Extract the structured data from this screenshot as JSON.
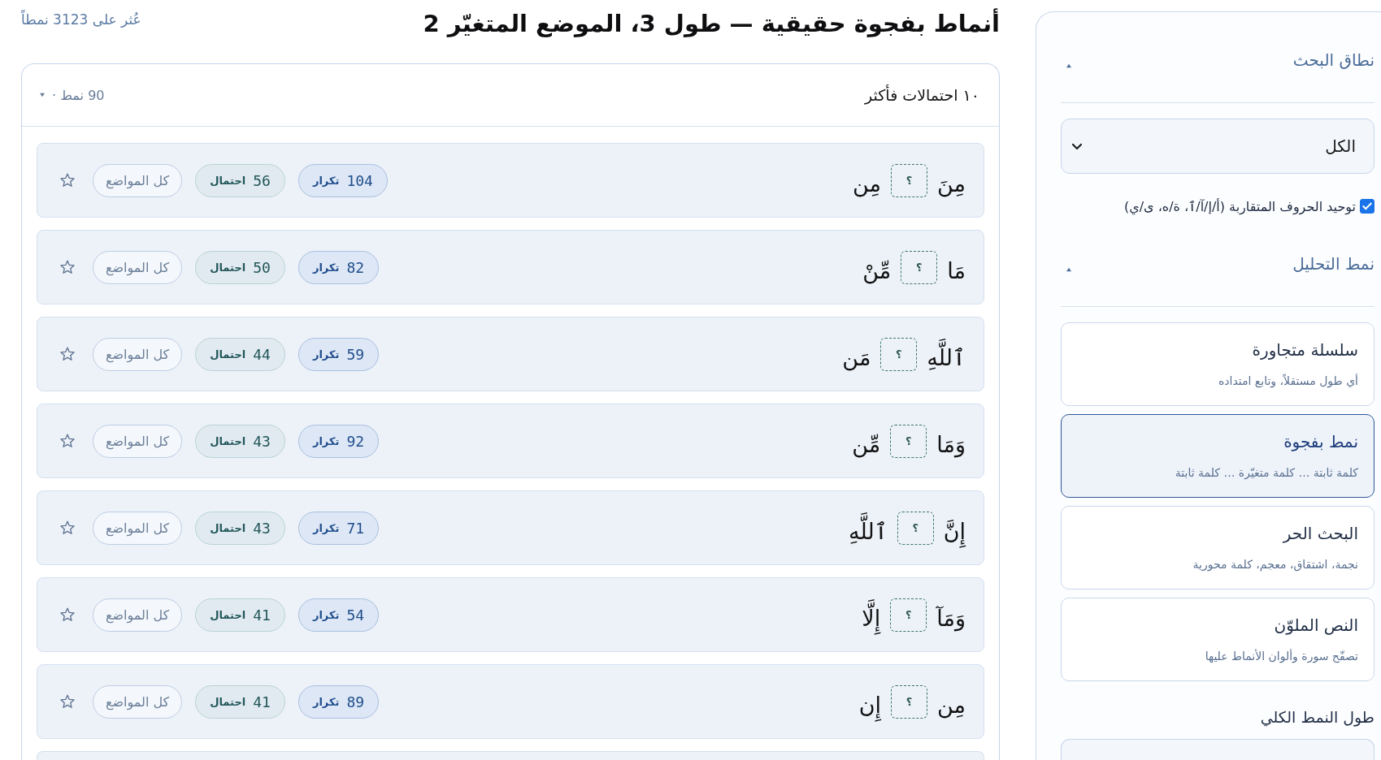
{
  "header": {
    "title": "أنماط بفجوة حقيقية — طول 3، الموضع المتغيّر 2",
    "found": "عُثر على 3123 نمطاً"
  },
  "results": {
    "heading": "١٠ احتمالات فأكثر",
    "count": "90 نمط ·",
    "expanded": true,
    "rows": [
      {
        "word_1": "مِنَ",
        "gap": "؟",
        "word_2": "مِن",
        "repeats": "104",
        "repeats_label": "تكرار",
        "options": "56",
        "options_label": "احتمال",
        "link": "كل المواضع",
        "starred": false
      },
      {
        "word_1": "مَا",
        "gap": "؟",
        "word_2": "مِّنْ",
        "repeats": "82",
        "repeats_label": "تكرار",
        "options": "50",
        "options_label": "احتمال",
        "link": "كل المواضع",
        "starred": false
      },
      {
        "word_1": "ٱللَّهِ",
        "gap": "؟",
        "word_2": "مَن",
        "repeats": "59",
        "repeats_label": "تكرار",
        "options": "44",
        "options_label": "احتمال",
        "link": "كل المواضع",
        "starred": false
      },
      {
        "word_1": "وَمَا",
        "gap": "؟",
        "word_2": "مِّن",
        "repeats": "92",
        "repeats_label": "تكرار",
        "options": "43",
        "options_label": "احتمال",
        "link": "كل المواضع",
        "starred": false
      },
      {
        "word_1": "إِنَّ",
        "gap": "؟",
        "word_2": "ٱللَّهِ",
        "repeats": "71",
        "repeats_label": "تكرار",
        "options": "43",
        "options_label": "احتمال",
        "link": "كل المواضع",
        "starred": false
      },
      {
        "word_1": "وَمَآ",
        "gap": "؟",
        "word_2": "إِلَّا",
        "repeats": "54",
        "repeats_label": "تكرار",
        "options": "41",
        "options_label": "احتمال",
        "link": "كل المواضع",
        "starred": false
      },
      {
        "word_1": "مِن",
        "gap": "؟",
        "word_2": "إِن",
        "repeats": "89",
        "repeats_label": "تكرار",
        "options": "41",
        "options_label": "احتمال",
        "link": "كل المواضع",
        "starred": false
      }
    ]
  },
  "sidebar": {
    "scope": {
      "heading": "نطاق البحث",
      "expanded": true,
      "select": "الكل",
      "normalize": {
        "label": "توحيد الحروف المتقاربة (أ/إ/آ/ٱ، ة/ه، ى/ي)",
        "checked": true
      }
    },
    "analysis": {
      "heading": "نمط التحليل",
      "expanded": true,
      "modes": [
        {
          "title": "سلسلة متجاورة",
          "description": "أي طول مستقلاً، وتابع امتداده",
          "selected": false
        },
        {
          "title": "نمط بفجوة",
          "description": "كلمة ثابتة … كلمة متغيّرة … كلمة ثابتة",
          "selected": true
        },
        {
          "title": "البحث الحر",
          "description": "نجمة، اشتقاق، معجم، كلمة محورية",
          "selected": false
        },
        {
          "title": "النص الملوّن",
          "description": "تصفّح سورة وألوان الأنماط عليها",
          "selected": false
        }
      ]
    },
    "length": {
      "label": "طول النمط الكلي"
    }
  }
}
